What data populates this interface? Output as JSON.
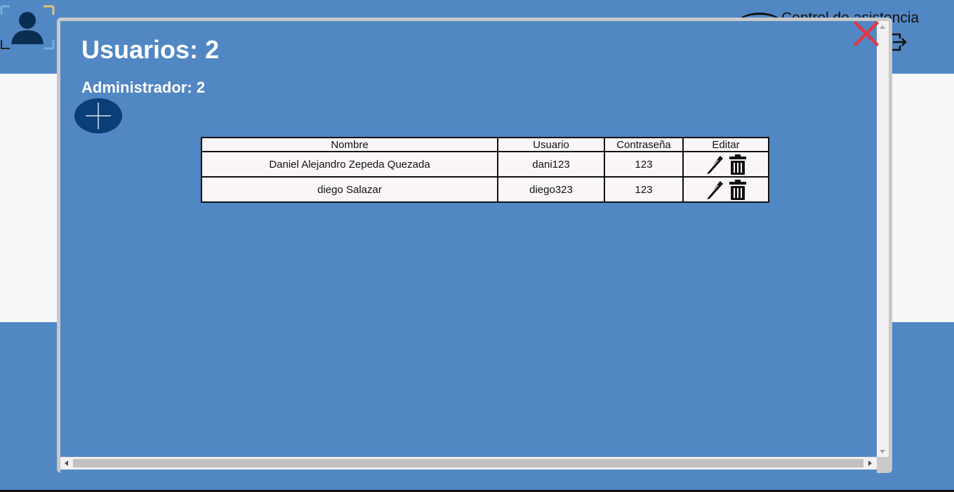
{
  "background": {
    "app_title": "Control de asistencia"
  },
  "modal": {
    "title_label": "Usuarios:",
    "title_count": "2",
    "subtitle_label": "Administrador:",
    "subtitle_count": "2",
    "close_icon": "close-x-icon",
    "add_icon": "plus-icon"
  },
  "table": {
    "headers": [
      "Nombre",
      "Usuario",
      "Contraseña",
      "Editar"
    ],
    "rows": [
      {
        "nombre": "Daniel Alejandro Zepeda Quezada",
        "usuario": "dani123",
        "contrasena": "123"
      },
      {
        "nombre": "diego Salazar",
        "usuario": "diego323",
        "contrasena": "123"
      }
    ]
  },
  "colors": {
    "primary_blue": "#5187c3",
    "dark_blue": "#0b3d77",
    "close_red": "#e03848",
    "band_white": "#f7f7f9"
  }
}
